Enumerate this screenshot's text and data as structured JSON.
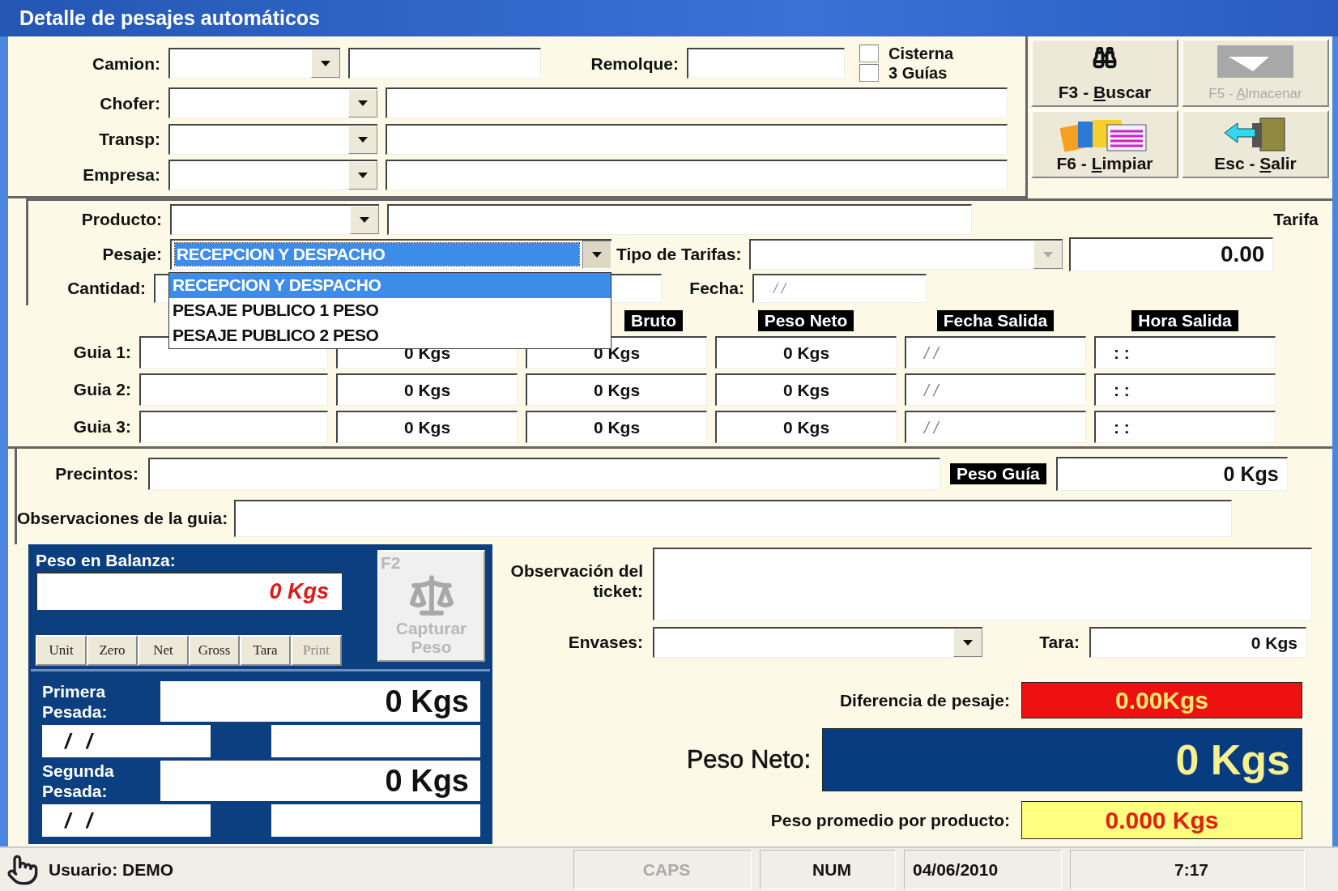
{
  "window": {
    "title": "Detalle de pesajes automáticos"
  },
  "camion": {
    "label": "Camion:"
  },
  "remolque": {
    "label": "Remolque:"
  },
  "checkboxes": [
    {
      "label": "Cisterna",
      "checked": false
    },
    {
      "label": "3 Guías",
      "checked": false
    }
  ],
  "party_fields": [
    {
      "label": "Chofer:"
    },
    {
      "label": "Transp:"
    },
    {
      "label": "Empresa:"
    }
  ],
  "actions": [
    {
      "prefix": "F3 - ",
      "mnemonic": "B",
      "rest": "uscar",
      "disabled": false
    },
    {
      "prefix": "F5 - ",
      "mnemonic": "A",
      "rest": "lmacenar",
      "disabled": true
    },
    {
      "prefix": "F6 - ",
      "mnemonic": "L",
      "rest": "impiar",
      "disabled": false
    },
    {
      "prefix": "Esc - ",
      "mnemonic": "S",
      "rest": "alir",
      "disabled": false
    }
  ],
  "producto": {
    "label": "Producto:"
  },
  "tarifa": {
    "label": "Tarifa",
    "value": "0.00"
  },
  "pesaje": {
    "label": "Pesaje:",
    "value": "RECEPCION Y DESPACHO",
    "expanded": true,
    "options": [
      {
        "label": "RECEPCION Y DESPACHO",
        "selected": true
      },
      {
        "label": "PESAJE PUBLICO 1 PESO",
        "selected": false
      },
      {
        "label": "PESAJE PUBLICO 2 PESO",
        "selected": false
      }
    ]
  },
  "tipo_tarifas": {
    "label": "Tipo de Tarifas:",
    "disabled": true
  },
  "cantidad": {
    "label": "Cantidad:"
  },
  "fecha": {
    "label": "Fecha:",
    "value": "/ /"
  },
  "guias": {
    "columns": [
      "",
      "Bruto",
      "Peso Neto",
      "Fecha Salida",
      "Hora Salida"
    ],
    "rows": [
      {
        "label": "Guia 1:",
        "cells": [
          "0 Kgs",
          "0 Kgs",
          "0 Kgs",
          "/ /",
          ": :"
        ]
      },
      {
        "label": "Guia 2:",
        "cells": [
          "0 Kgs",
          "0 Kgs",
          "0 Kgs",
          "/ /",
          ": :"
        ]
      },
      {
        "label": "Guia 3:",
        "cells": [
          "0 Kgs",
          "0 Kgs",
          "0 Kgs",
          "/ /",
          ": :"
        ]
      }
    ]
  },
  "precintos": {
    "label": "Precintos:"
  },
  "peso_guia": {
    "label": "Peso Guía",
    "value": "0 Kgs"
  },
  "observaciones_guia": {
    "label": "Observaciones de la guia:"
  },
  "balanza": {
    "label": "Peso en Balanza:",
    "value": "0 Kgs",
    "buttons": [
      {
        "label": "Unit",
        "disabled": false
      },
      {
        "label": "Zero",
        "disabled": false
      },
      {
        "label": "Net",
        "disabled": false
      },
      {
        "label": "Gross",
        "disabled": false
      },
      {
        "label": "Tara",
        "disabled": false
      },
      {
        "label": "Print",
        "disabled": true
      }
    ],
    "capture": {
      "key": "F2",
      "label": "Capturar Peso",
      "disabled": true
    }
  },
  "pesadas": [
    {
      "label": "Primera Pesada:",
      "value": "0 Kgs",
      "date": "/ /"
    },
    {
      "label": "Segunda Pesada:",
      "value": "0 Kgs",
      "date": "/ /"
    }
  ],
  "observacion_ticket": {
    "label": "Observación del ticket:"
  },
  "envases": {
    "label": "Envases:"
  },
  "tara": {
    "label": "Tara:",
    "value": "0 Kgs"
  },
  "summary": [
    {
      "kind": "difference",
      "label": "Diferencia de pesaje:",
      "value": "0.00Kgs"
    },
    {
      "kind": "net",
      "label": "Peso Neto:",
      "value": "0 Kgs"
    },
    {
      "kind": "average",
      "label": "Peso promedio por producto:",
      "value": "0.000 Kgs"
    }
  ],
  "status_bar": {
    "user": "Usuario: DEMO",
    "panels": [
      {
        "kind": "key",
        "label": "CAPS",
        "disabled": true
      },
      {
        "kind": "key",
        "label": "NUM",
        "disabled": false
      },
      {
        "kind": "date",
        "label": "04/06/2010",
        "disabled": false
      },
      {
        "kind": "time",
        "label": "7:17",
        "disabled": false
      }
    ]
  }
}
